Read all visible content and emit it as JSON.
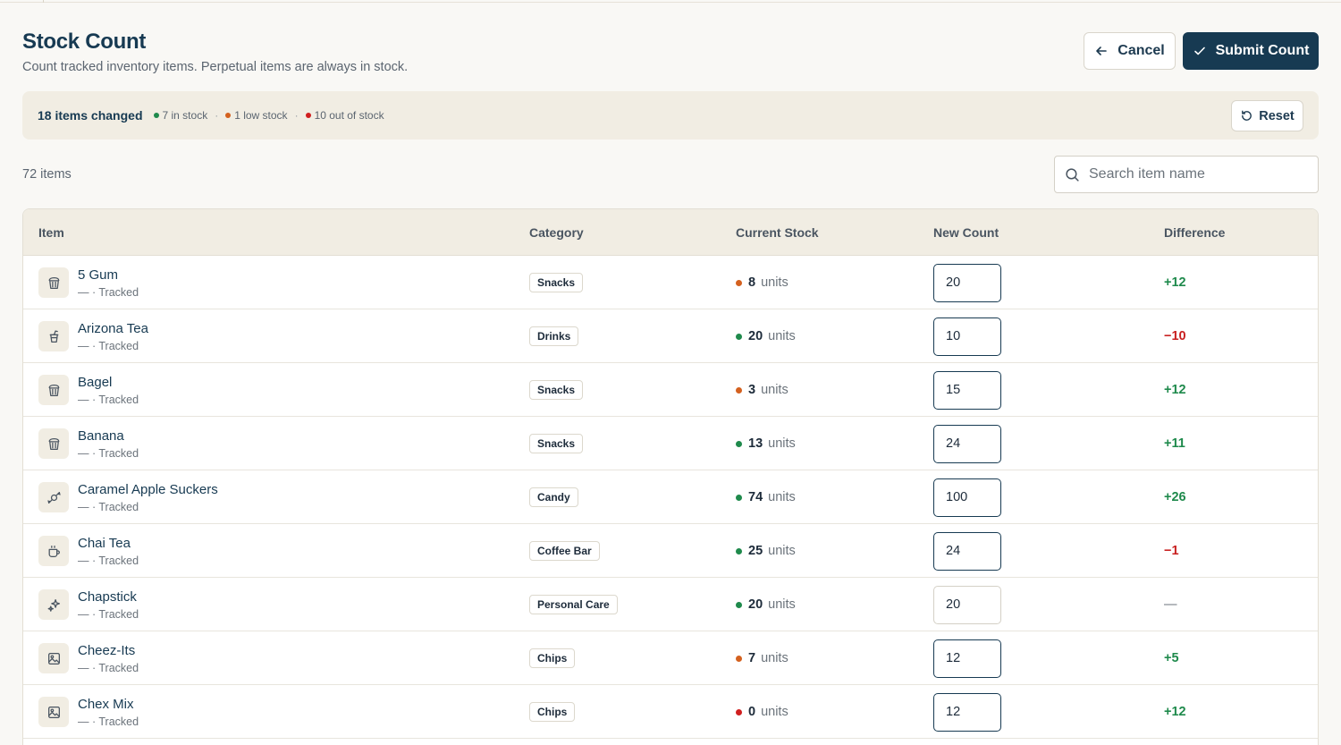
{
  "page": {
    "title": "Stock Count",
    "subtitle": "Count tracked inventory items. Perpetual items are always in stock."
  },
  "actions": {
    "cancel_label": "Cancel",
    "submit_label": "Submit Count",
    "reset_label": "Reset"
  },
  "summary": {
    "changed": "18 items changed",
    "in_stock": "7 in stock",
    "low_stock": "1 low stock",
    "out_of_stock": "10 out of stock",
    "separator": "·"
  },
  "list": {
    "count": "72 items",
    "search_placeholder": "Search item name"
  },
  "columns": {
    "item": "Item",
    "category": "Category",
    "current_stock": "Current Stock",
    "new_count": "New Count",
    "difference": "Difference"
  },
  "colors": {
    "primary": "#173a52",
    "in_stock": "#1f8a4c",
    "low_stock": "#d4611f",
    "out_of_stock": "#d01f1f",
    "positive": "#1f8a4c",
    "negative": "#c81f1f",
    "neutral": "#6b737b"
  },
  "rows": [
    {
      "name": "5 Gum",
      "meta": "— · Tracked",
      "icon": "snack-icon",
      "category": "Snacks",
      "stock": "8",
      "unit": "units",
      "status": "low",
      "new_count": "20",
      "diff": "+12",
      "diff_type": "positive"
    },
    {
      "name": "Arizona Tea",
      "meta": "— · Tracked",
      "icon": "drink-cup-icon",
      "category": "Drinks",
      "stock": "20",
      "unit": "units",
      "status": "in",
      "new_count": "10",
      "diff": "−10",
      "diff_type": "negative"
    },
    {
      "name": "Bagel",
      "meta": "— · Tracked",
      "icon": "snack-icon",
      "category": "Snacks",
      "stock": "3",
      "unit": "units",
      "status": "low",
      "new_count": "15",
      "diff": "+12",
      "diff_type": "positive"
    },
    {
      "name": "Banana",
      "meta": "— · Tracked",
      "icon": "snack-icon",
      "category": "Snacks",
      "stock": "13",
      "unit": "units",
      "status": "in",
      "new_count": "24",
      "diff": "+11",
      "diff_type": "positive"
    },
    {
      "name": "Caramel Apple Suckers",
      "meta": "— · Tracked",
      "icon": "candy-icon",
      "category": "Candy",
      "stock": "74",
      "unit": "units",
      "status": "in",
      "new_count": "100",
      "diff": "+26",
      "diff_type": "positive"
    },
    {
      "name": "Chai Tea",
      "meta": "— · Tracked",
      "icon": "coffee-cup-icon",
      "category": "Coffee Bar",
      "stock": "25",
      "unit": "units",
      "status": "in",
      "new_count": "24",
      "diff": "−1",
      "diff_type": "negative"
    },
    {
      "name": "Chapstick",
      "meta": "— · Tracked",
      "icon": "sparkle-icon",
      "category": "Personal Care",
      "stock": "20",
      "unit": "units",
      "status": "in",
      "new_count": "20",
      "diff": "—",
      "diff_type": "neutral"
    },
    {
      "name": "Cheez-Its",
      "meta": "— · Tracked",
      "icon": "image-icon",
      "category": "Chips",
      "stock": "7",
      "unit": "units",
      "status": "low",
      "new_count": "12",
      "diff": "+5",
      "diff_type": "positive"
    },
    {
      "name": "Chex Mix",
      "meta": "— · Tracked",
      "icon": "image-icon",
      "category": "Chips",
      "stock": "0",
      "unit": "units",
      "status": "out",
      "new_count": "12",
      "diff": "+12",
      "diff_type": "positive"
    }
  ]
}
